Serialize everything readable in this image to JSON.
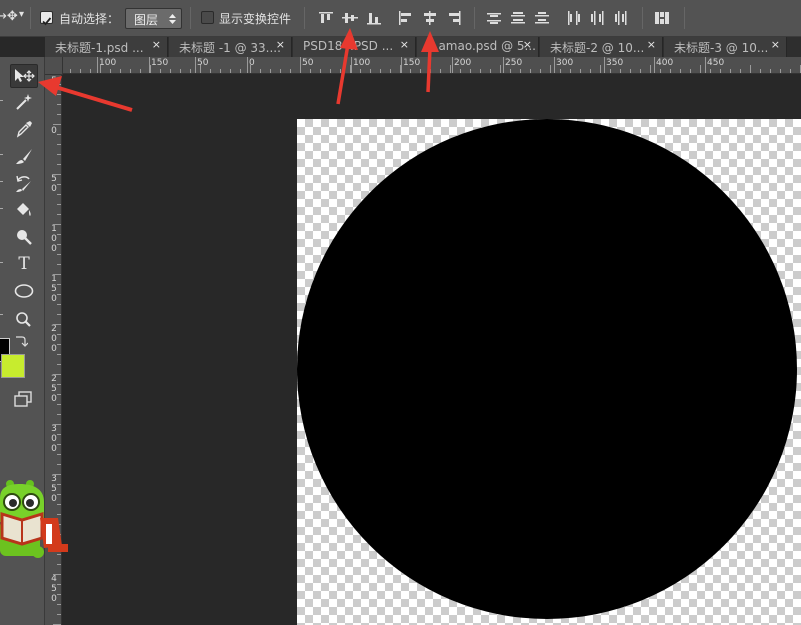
{
  "options_bar": {
    "move_icon_glyph": "↔✥",
    "dropdown_glyph": "▾",
    "auto_select_label": "自动选择：",
    "auto_select_checked": true,
    "auto_select_target": "图层",
    "show_transform_label": "显示变换控件",
    "show_transform_checked": false,
    "align_icons": [
      "align-top-edges-icon",
      "align-vertical-centers-icon",
      "align-bottom-edges-icon",
      "align-left-edges-icon",
      "align-horizontal-centers-icon",
      "align-right-edges-icon"
    ],
    "distribute_icons": [
      "distribute-top-icon",
      "distribute-vertical-centers-icon",
      "distribute-bottom-icon",
      "distribute-left-icon",
      "distribute-horizontal-centers-icon",
      "distribute-right-icon",
      "auto-align-layers-icon"
    ]
  },
  "tabs": [
    {
      "label": "未标题-1.psd ...",
      "close": "×"
    },
    {
      "label": "未标题 -1 @ 33....",
      "close": "×"
    },
    {
      "label": "PSD184.PSD ...",
      "close": "×"
    },
    {
      "label": "...amao.psd @ 5...",
      "close": "×"
    },
    {
      "label": "未标题-2 @ 10...",
      "close": "×"
    },
    {
      "label": "未标题-3 @ 10...",
      "close": "×"
    }
  ],
  "toolbox": {
    "tools": [
      "move-tool",
      "magic-wand-tool",
      "eyedropper-tool",
      "brush-tool",
      "history-brush-tool",
      "paint-bucket-tool",
      "dodge-tool",
      "type-tool",
      "ellipse-tool",
      "zoom-tool"
    ],
    "type_tool_glyph": "T",
    "foreground_color": "#000000",
    "background_color": "#c7ec2e"
  },
  "ruler_top": [
    "0",
    "100",
    "150",
    "50",
    "0",
    "50",
    "100",
    "150",
    "200",
    "250",
    "300",
    "350",
    "400",
    "450"
  ],
  "ruler_left": [
    "5",
    "0",
    "5 0",
    "1 0 0",
    "1 5 0",
    "2 0 0",
    "2 5 0",
    "3 0 0",
    "3 5 0",
    "4 0 0",
    "4 5 0"
  ],
  "canvas": {
    "shape": "ellipse",
    "fill": "#000000",
    "background": "transparent-checkerboard"
  },
  "annotations": {
    "arrow_color": "#e8392f"
  }
}
